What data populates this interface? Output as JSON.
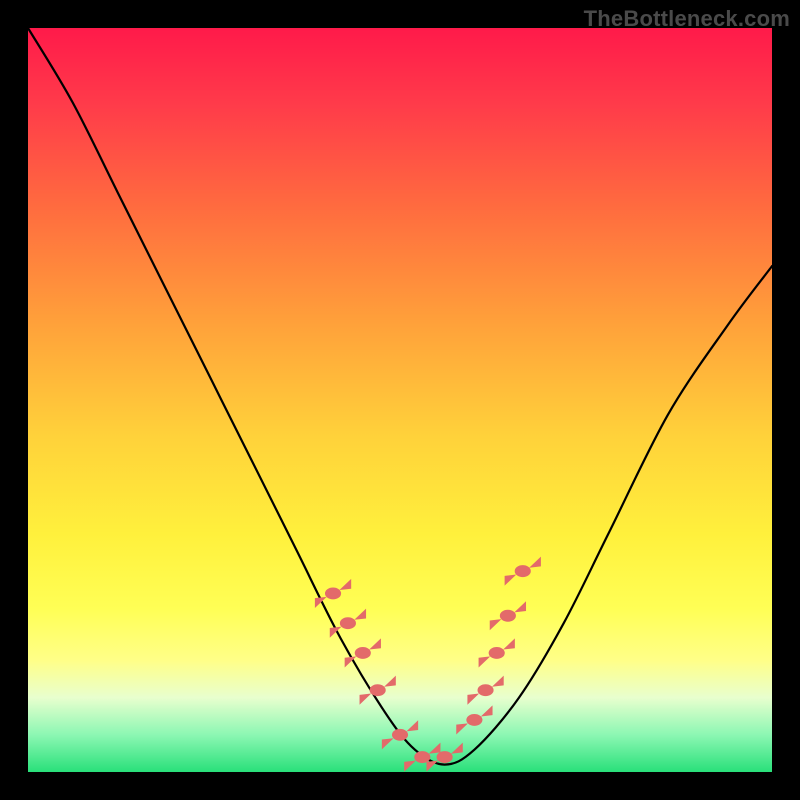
{
  "watermark": "TheBottleneck.com",
  "chart_data": {
    "type": "line",
    "title": "",
    "xlabel": "",
    "ylabel": "",
    "xlim": [
      0,
      100
    ],
    "ylim": [
      0,
      100
    ],
    "grid": false,
    "legend": false,
    "series": [
      {
        "name": "bottleneck-curve",
        "x": [
          0,
          6,
          12,
          18,
          24,
          30,
          36,
          42,
          48,
          52,
          56,
          60,
          66,
          72,
          78,
          86,
          94,
          100
        ],
        "y": [
          100,
          90,
          78,
          66,
          54,
          42,
          30,
          18,
          8,
          3,
          1,
          3,
          10,
          20,
          32,
          48,
          60,
          68
        ]
      }
    ],
    "markers": {
      "name": "highlight-points",
      "shape": "candy",
      "color": "#e36a6a",
      "x_pct": [
        41,
        43,
        45,
        47,
        50,
        53,
        56,
        60,
        61.5,
        63,
        64.5,
        66.5
      ],
      "y_pct": [
        24,
        20,
        16,
        11,
        5,
        2,
        2,
        7,
        11,
        16,
        21,
        27
      ]
    }
  }
}
